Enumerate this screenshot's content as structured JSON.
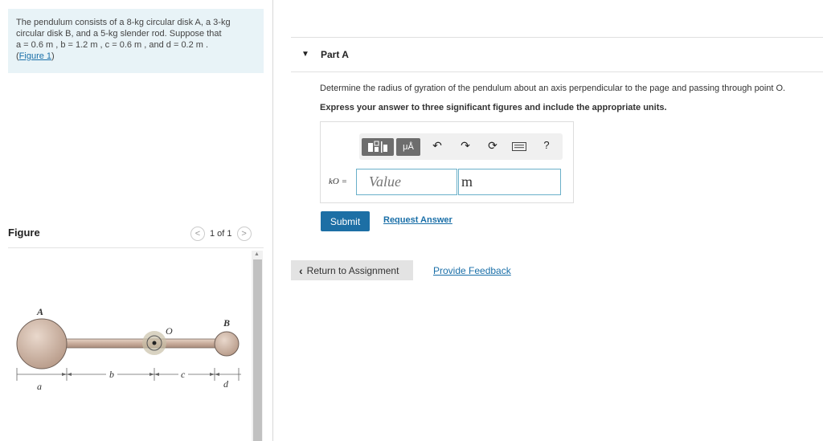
{
  "problem": {
    "line1": "The pendulum consists of a 8-kg circular disk A, a 3-kg",
    "line2": "circular disk B, and a 5-kg slender rod. Suppose that",
    "line3": "a = 0.6  m , b = 1.2  m , c = 0.6  m , and d = 0.2  m .",
    "link_open": "(",
    "link": "Figure 1",
    "link_close": ")"
  },
  "figure": {
    "label": "Figure",
    "pager_text": "1 of 1",
    "labels": {
      "A": "A",
      "B": "B",
      "O": "O",
      "a": "a",
      "b": "b",
      "c": "c",
      "d": "d"
    }
  },
  "part": {
    "caret": "▼",
    "title": "Part A",
    "question": "Determine the radius of gyration of the pendulum about an axis perpendicular to the page and passing through point O.",
    "instruction": "Express your answer to three significant figures and include the appropriate units."
  },
  "answer": {
    "variable_label": "kO =",
    "value_placeholder": "Value",
    "units_value": "m"
  },
  "toolbar": {
    "templates_icon": "templates-icon",
    "units_label": "μÅ",
    "undo_icon": "undo-icon",
    "redo_icon": "redo-icon",
    "reset_icon": "reset-icon",
    "keyboard_icon": "keyboard-icon",
    "help_label": "?"
  },
  "buttons": {
    "submit": "Submit",
    "request_answer": "Request Answer",
    "return_icon": "chevron-left-icon",
    "return": "Return to Assignment",
    "feedback": "Provide Feedback"
  },
  "colors": {
    "primary": "#1d6fa5",
    "problem_bg": "#e8f3f7",
    "input_border": "#6ab0c9"
  }
}
